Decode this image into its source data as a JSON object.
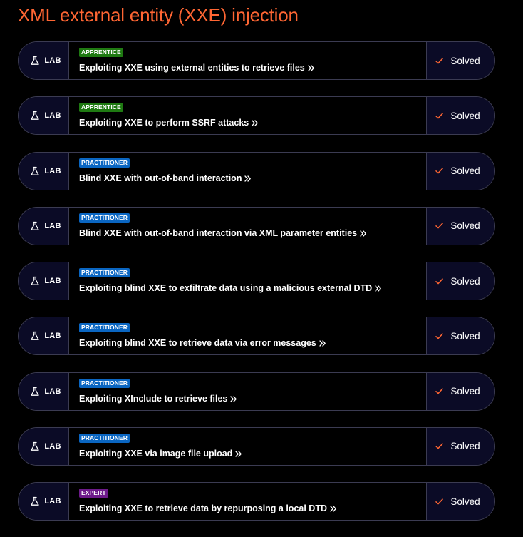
{
  "page": {
    "title": "XML external entity (XXE) injection"
  },
  "colors": {
    "title": "#ff6633",
    "apprentice_badge": "#1f7a12",
    "practitioner_badge": "#0a66c2",
    "expert_badge": "#6d1a8a",
    "check": "#ff6633",
    "cell_background": "#0b0b26"
  },
  "icons": {
    "lab": "flask-icon",
    "link": "chevron-double-right-icon",
    "status": "check-icon"
  },
  "labs": [
    {
      "tag": "LAB",
      "level": "APPRENTICE",
      "level_key": "apprentice",
      "title": "Exploiting XXE using external entities to retrieve files",
      "status": "Solved"
    },
    {
      "tag": "LAB",
      "level": "APPRENTICE",
      "level_key": "apprentice",
      "title": "Exploiting XXE to perform SSRF attacks",
      "status": "Solved"
    },
    {
      "tag": "LAB",
      "level": "PRACTITIONER",
      "level_key": "practitioner",
      "title": "Blind XXE with out-of-band interaction",
      "status": "Solved"
    },
    {
      "tag": "LAB",
      "level": "PRACTITIONER",
      "level_key": "practitioner",
      "title": "Blind XXE with out-of-band interaction via XML parameter entities",
      "status": "Solved"
    },
    {
      "tag": "LAB",
      "level": "PRACTITIONER",
      "level_key": "practitioner",
      "title": "Exploiting blind XXE to exfiltrate data using a malicious external DTD",
      "status": "Solved"
    },
    {
      "tag": "LAB",
      "level": "PRACTITIONER",
      "level_key": "practitioner",
      "title": "Exploiting blind XXE to retrieve data via error messages",
      "status": "Solved"
    },
    {
      "tag": "LAB",
      "level": "PRACTITIONER",
      "level_key": "practitioner",
      "title": "Exploiting XInclude to retrieve files",
      "status": "Solved"
    },
    {
      "tag": "LAB",
      "level": "PRACTITIONER",
      "level_key": "practitioner",
      "title": "Exploiting XXE via image file upload",
      "status": "Solved"
    },
    {
      "tag": "LAB",
      "level": "EXPERT",
      "level_key": "expert",
      "title": "Exploiting XXE to retrieve data by repurposing a local DTD",
      "status": "Solved"
    }
  ]
}
